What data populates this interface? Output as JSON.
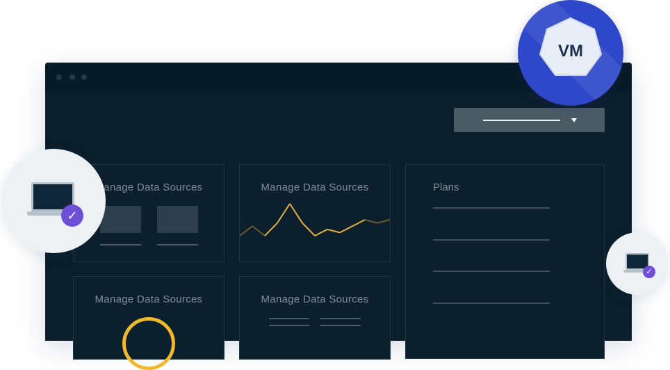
{
  "window": {
    "title_dots": 3
  },
  "dropdown": {
    "icon": "chevron-down-icon"
  },
  "cards": [
    {
      "title": "Manage Data Sources"
    },
    {
      "title": "Manage Data Sources"
    },
    {
      "title": "Manage Data Sources"
    },
    {
      "title": "Manage Data Sources"
    }
  ],
  "plans": {
    "title": "Plans",
    "lines": 4
  },
  "vm_badge": {
    "label": "VM"
  },
  "colors": {
    "window_bg": "#0b1e2c",
    "accent_check": "#6c4fd6",
    "vm_blue": "#2f48c9",
    "line_chart": "#e2b33f"
  },
  "chart_data": {
    "type": "line",
    "series": [
      {
        "values": [
          0,
          3,
          0,
          4,
          10,
          4,
          0,
          2,
          1,
          3,
          5,
          4,
          5
        ]
      }
    ]
  }
}
